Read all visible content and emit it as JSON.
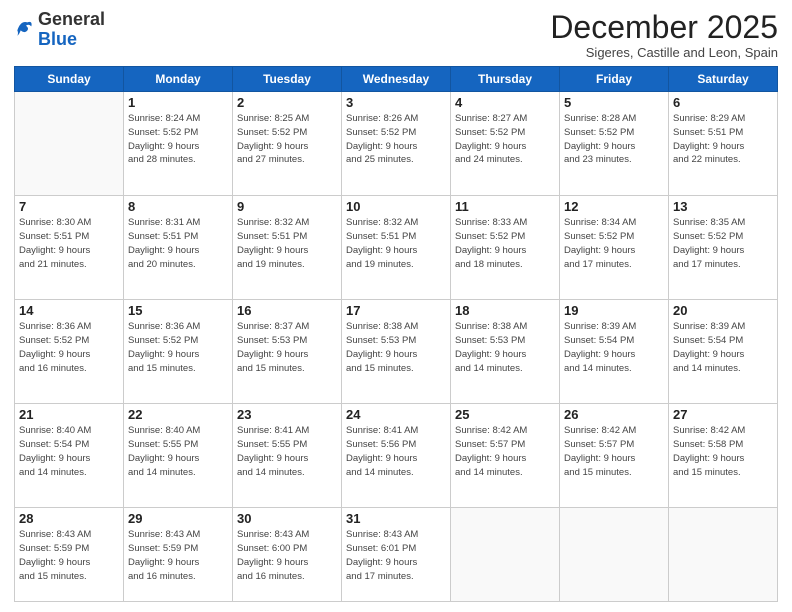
{
  "header": {
    "logo_general": "General",
    "logo_blue": "Blue",
    "month_title": "December 2025",
    "subtitle": "Sigeres, Castille and Leon, Spain"
  },
  "days_of_week": [
    "Sunday",
    "Monday",
    "Tuesday",
    "Wednesday",
    "Thursday",
    "Friday",
    "Saturday"
  ],
  "weeks": [
    [
      {
        "day": "",
        "info": ""
      },
      {
        "day": "1",
        "info": "Sunrise: 8:24 AM\nSunset: 5:52 PM\nDaylight: 9 hours\nand 28 minutes."
      },
      {
        "day": "2",
        "info": "Sunrise: 8:25 AM\nSunset: 5:52 PM\nDaylight: 9 hours\nand 27 minutes."
      },
      {
        "day": "3",
        "info": "Sunrise: 8:26 AM\nSunset: 5:52 PM\nDaylight: 9 hours\nand 25 minutes."
      },
      {
        "day": "4",
        "info": "Sunrise: 8:27 AM\nSunset: 5:52 PM\nDaylight: 9 hours\nand 24 minutes."
      },
      {
        "day": "5",
        "info": "Sunrise: 8:28 AM\nSunset: 5:52 PM\nDaylight: 9 hours\nand 23 minutes."
      },
      {
        "day": "6",
        "info": "Sunrise: 8:29 AM\nSunset: 5:51 PM\nDaylight: 9 hours\nand 22 minutes."
      }
    ],
    [
      {
        "day": "7",
        "info": "Sunrise: 8:30 AM\nSunset: 5:51 PM\nDaylight: 9 hours\nand 21 minutes."
      },
      {
        "day": "8",
        "info": "Sunrise: 8:31 AM\nSunset: 5:51 PM\nDaylight: 9 hours\nand 20 minutes."
      },
      {
        "day": "9",
        "info": "Sunrise: 8:32 AM\nSunset: 5:51 PM\nDaylight: 9 hours\nand 19 minutes."
      },
      {
        "day": "10",
        "info": "Sunrise: 8:32 AM\nSunset: 5:51 PM\nDaylight: 9 hours\nand 19 minutes."
      },
      {
        "day": "11",
        "info": "Sunrise: 8:33 AM\nSunset: 5:52 PM\nDaylight: 9 hours\nand 18 minutes."
      },
      {
        "day": "12",
        "info": "Sunrise: 8:34 AM\nSunset: 5:52 PM\nDaylight: 9 hours\nand 17 minutes."
      },
      {
        "day": "13",
        "info": "Sunrise: 8:35 AM\nSunset: 5:52 PM\nDaylight: 9 hours\nand 17 minutes."
      }
    ],
    [
      {
        "day": "14",
        "info": "Sunrise: 8:36 AM\nSunset: 5:52 PM\nDaylight: 9 hours\nand 16 minutes."
      },
      {
        "day": "15",
        "info": "Sunrise: 8:36 AM\nSunset: 5:52 PM\nDaylight: 9 hours\nand 15 minutes."
      },
      {
        "day": "16",
        "info": "Sunrise: 8:37 AM\nSunset: 5:53 PM\nDaylight: 9 hours\nand 15 minutes."
      },
      {
        "day": "17",
        "info": "Sunrise: 8:38 AM\nSunset: 5:53 PM\nDaylight: 9 hours\nand 15 minutes."
      },
      {
        "day": "18",
        "info": "Sunrise: 8:38 AM\nSunset: 5:53 PM\nDaylight: 9 hours\nand 14 minutes."
      },
      {
        "day": "19",
        "info": "Sunrise: 8:39 AM\nSunset: 5:54 PM\nDaylight: 9 hours\nand 14 minutes."
      },
      {
        "day": "20",
        "info": "Sunrise: 8:39 AM\nSunset: 5:54 PM\nDaylight: 9 hours\nand 14 minutes."
      }
    ],
    [
      {
        "day": "21",
        "info": "Sunrise: 8:40 AM\nSunset: 5:54 PM\nDaylight: 9 hours\nand 14 minutes."
      },
      {
        "day": "22",
        "info": "Sunrise: 8:40 AM\nSunset: 5:55 PM\nDaylight: 9 hours\nand 14 minutes."
      },
      {
        "day": "23",
        "info": "Sunrise: 8:41 AM\nSunset: 5:55 PM\nDaylight: 9 hours\nand 14 minutes."
      },
      {
        "day": "24",
        "info": "Sunrise: 8:41 AM\nSunset: 5:56 PM\nDaylight: 9 hours\nand 14 minutes."
      },
      {
        "day": "25",
        "info": "Sunrise: 8:42 AM\nSunset: 5:57 PM\nDaylight: 9 hours\nand 14 minutes."
      },
      {
        "day": "26",
        "info": "Sunrise: 8:42 AM\nSunset: 5:57 PM\nDaylight: 9 hours\nand 15 minutes."
      },
      {
        "day": "27",
        "info": "Sunrise: 8:42 AM\nSunset: 5:58 PM\nDaylight: 9 hours\nand 15 minutes."
      }
    ],
    [
      {
        "day": "28",
        "info": "Sunrise: 8:43 AM\nSunset: 5:59 PM\nDaylight: 9 hours\nand 15 minutes."
      },
      {
        "day": "29",
        "info": "Sunrise: 8:43 AM\nSunset: 5:59 PM\nDaylight: 9 hours\nand 16 minutes."
      },
      {
        "day": "30",
        "info": "Sunrise: 8:43 AM\nSunset: 6:00 PM\nDaylight: 9 hours\nand 16 minutes."
      },
      {
        "day": "31",
        "info": "Sunrise: 8:43 AM\nSunset: 6:01 PM\nDaylight: 9 hours\nand 17 minutes."
      },
      {
        "day": "",
        "info": ""
      },
      {
        "day": "",
        "info": ""
      },
      {
        "day": "",
        "info": ""
      }
    ]
  ]
}
